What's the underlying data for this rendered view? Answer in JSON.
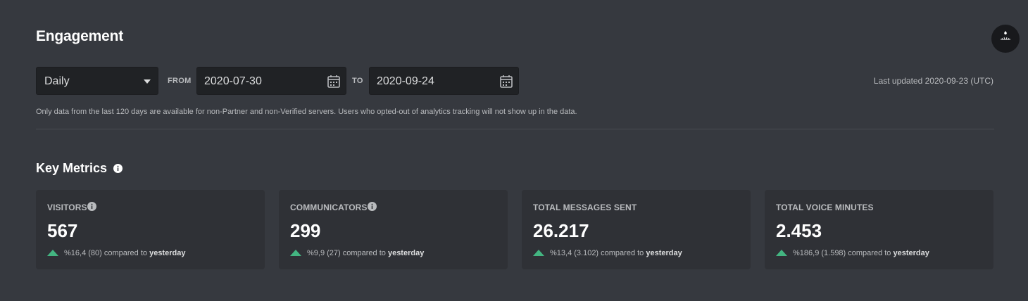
{
  "header": {
    "title": "Engagement",
    "last_updated": "Last updated 2020-09-23 (UTC)"
  },
  "controls": {
    "interval": "Daily",
    "from_label": "FROM",
    "from_date": "2020-07-30",
    "to_label": "TO",
    "to_date": "2020-09-24"
  },
  "note": "Only data from the last 120 days are available for non-Partner and non-Verified servers. Users who opted-out of analytics tracking will not show up in the data.",
  "key_metrics": {
    "title": "Key Metrics",
    "cards": [
      {
        "label": "VISITORS",
        "value": "567",
        "change": "%16,4 (80) compared to",
        "ref": "yesterday",
        "has_info": true
      },
      {
        "label": "COMMUNICATORS",
        "value": "299",
        "change": "%9,9 (27) compared to",
        "ref": "yesterday",
        "has_info": true
      },
      {
        "label": "TOTAL MESSAGES SENT",
        "value": "26.217",
        "change": "%13,4 (3.102) compared to",
        "ref": "yesterday",
        "has_info": false
      },
      {
        "label": "TOTAL VOICE MINUTES",
        "value": "2.453",
        "change": "%186,9 (1.598) compared to",
        "ref": "yesterday",
        "has_info": false
      }
    ]
  },
  "colors": {
    "background": "#36393f",
    "card": "#2f3136",
    "input": "#202225",
    "positive": "#43b581"
  },
  "icons": {
    "dropdown": "chevron-down-icon",
    "calendar": "calendar-icon",
    "info": "info-icon",
    "trend": "arrow-up-icon"
  }
}
